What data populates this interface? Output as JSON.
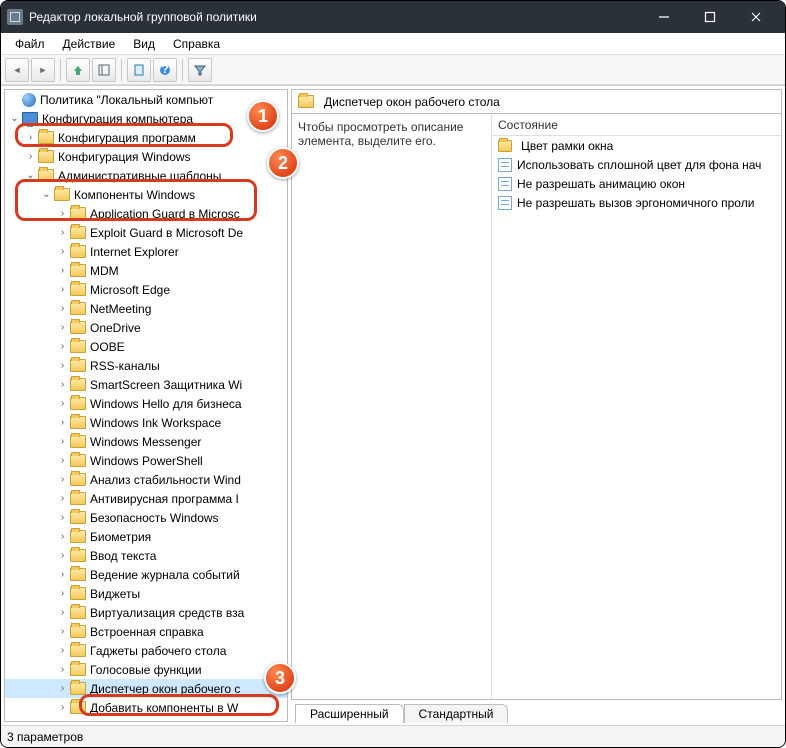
{
  "window": {
    "title": "Редактор локальной групповой политики"
  },
  "menu": {
    "file": "Файл",
    "action": "Действие",
    "view": "Вид",
    "help": "Справка"
  },
  "tree": {
    "root": "Политика \"Локальный компьют",
    "comp": "Конфигурация компьютера",
    "sw": "Конфигурация программ",
    "win": "Конфигурация Windows",
    "adm": "Административные шаблоны",
    "comps": "Компоненты Windows",
    "items": [
      "Application Guard в Microsc",
      "Exploit Guard в Microsoft De",
      "Internet Explorer",
      "MDM",
      "Microsoft Edge",
      "NetMeeting",
      "OneDrive",
      "OOBE",
      "RSS-каналы",
      "SmartScreen Защитника Wi",
      "Windows Hello для бизнеса",
      "Windows Ink Workspace",
      "Windows Messenger",
      "Windows PowerShell",
      "Анализ стабильности Wind",
      "Антивирусная программа I",
      "Безопасность Windows",
      "Биометрия",
      "Ввод текста",
      "Ведение журнала событий",
      "Виджеты",
      "Виртуализация средств вза",
      "Встроенная справка",
      "Гаджеты рабочего стола",
      "Голосовые функции",
      "Диспетчер окон рабочего с",
      "Добавить компоненты в W"
    ],
    "selected_index": 25
  },
  "details": {
    "header": "Диспетчер окон рабочего стола",
    "desc": "Чтобы просмотреть описание элемента, выделите его.",
    "col": "Состояние",
    "items": [
      "Цвет рамки окна",
      "Использовать сплошной цвет для фона нач",
      "Не разрешать анимацию окон",
      "Не разрешать вызов эргономичного проли"
    ]
  },
  "tabs": {
    "ext": "Расширенный",
    "std": "Стандартный"
  },
  "status": {
    "text": "3 параметров"
  },
  "badges": {
    "b1": "1",
    "b2": "2",
    "b3": "3"
  }
}
